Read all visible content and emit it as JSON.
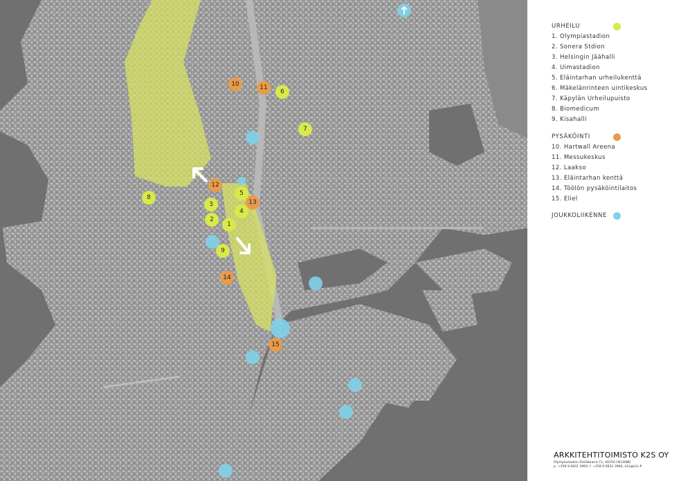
{
  "map": {
    "sports_markers": [
      {
        "num": "1"
      },
      {
        "num": "2"
      },
      {
        "num": "3"
      },
      {
        "num": "4"
      },
      {
        "num": "5"
      },
      {
        "num": "6"
      },
      {
        "num": "7"
      },
      {
        "num": "8"
      },
      {
        "num": "9"
      }
    ],
    "parking_markers": [
      {
        "num": "10"
      },
      {
        "num": "11"
      },
      {
        "num": "12"
      },
      {
        "num": "13"
      },
      {
        "num": "14"
      },
      {
        "num": "15"
      }
    ],
    "colors": {
      "sports": "#d9e94a",
      "parking": "#e99b4a",
      "transit": "#7fd2ea",
      "park": "#d8e35f"
    }
  },
  "legend": {
    "sports": {
      "title": "URHEILU",
      "items": [
        "1. Olympiastadion",
        "2. Sonera Stdion",
        "3. Helsingin Jäähalli",
        "4. Uimastadion",
        "5. Eläintarhan urheilukenttä",
        "6. Mäkelänrinteen uintikeskus",
        "7. Käpylän Urheilupuisto",
        "8. Biomedicum",
        "9. Kisahalli"
      ]
    },
    "parking": {
      "title": "PYSÄKÖINTI",
      "items": [
        "10. Hartwall Areena",
        "11. Messukeskus",
        "12. Laakso",
        "13. Eläintarhan kenttä",
        "14. Töölön pysäköintilaitos",
        "15. Eliel"
      ]
    },
    "transit": {
      "title": "JOUKKOLIIKENNE"
    }
  },
  "office": {
    "name": "ARKKITEHTITOIMISTO K2S OY",
    "address": "Olympiastadion Eteläkaarre C1, 00250 HELSINKI",
    "contact": "p. +358 9 6831 3960, f. +358 9 6831 3960, k2s@k2s.fi"
  }
}
